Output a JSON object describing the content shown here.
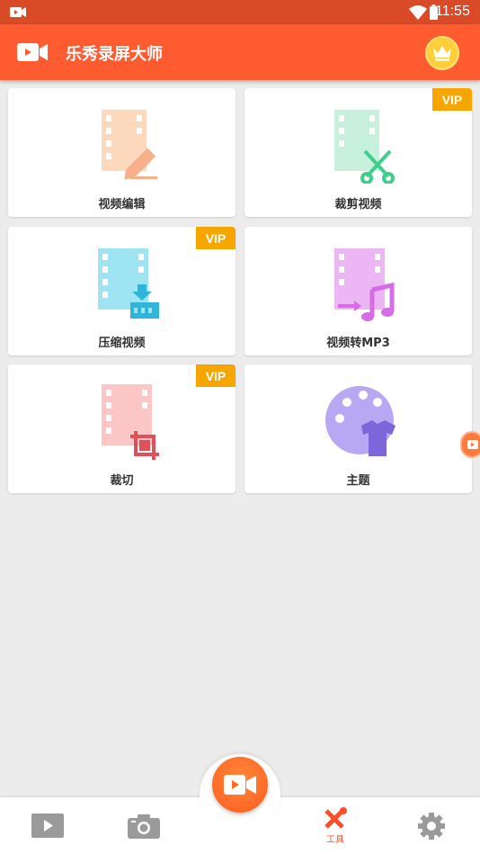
{
  "status_bar": {
    "time": "11:55"
  },
  "app_bar": {
    "title": "乐秀录屏大师"
  },
  "tools": [
    {
      "label": "视频编辑",
      "vip": false,
      "icon": "film-edit-icon",
      "color": "#fcd9bd"
    },
    {
      "label": "裁剪视频",
      "vip": true,
      "vip_label": "VIP",
      "icon": "film-cut-icon",
      "color": "#c8f1dd"
    },
    {
      "label": "压缩视频",
      "vip": true,
      "vip_label": "VIP",
      "icon": "film-compress-icon",
      "color": "#9ee4f3"
    },
    {
      "label": "视频转MP3",
      "vip": false,
      "icon": "film-mp3-icon",
      "color": "#ecb6f4"
    },
    {
      "label": "裁切",
      "vip": true,
      "vip_label": "VIP",
      "icon": "film-crop-icon",
      "color": "#fdc6c6"
    },
    {
      "label": "主题",
      "vip": false,
      "icon": "theme-palette-icon",
      "color": "#b8a8f4"
    }
  ],
  "bottom_nav": {
    "items": [
      {
        "name": "videos",
        "icon": "play-icon"
      },
      {
        "name": "screenshots",
        "icon": "camera-icon"
      },
      {
        "name": "record",
        "icon": "video-camera-icon"
      },
      {
        "name": "tools",
        "icon": "tools-icon",
        "label": "工具",
        "active": true
      },
      {
        "name": "settings",
        "icon": "gear-icon"
      }
    ]
  },
  "colors": {
    "primary": "#ff5b31",
    "status_bar": "#d94a27",
    "vip": "#f7a600",
    "active_nav": "#ff4d2a"
  }
}
